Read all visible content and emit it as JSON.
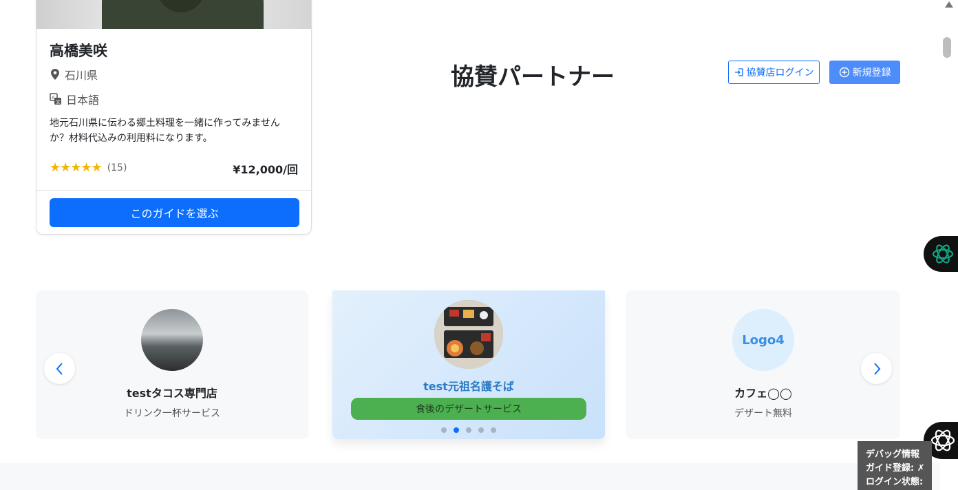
{
  "guide": {
    "name": "高橋美咲",
    "prefecture": "石川県",
    "language": "日本語",
    "description": "地元石川県に伝わる郷土料理を一緒に作ってみませんか？材料代込みの利用料になります。",
    "stars": "★★★★★",
    "rating": 5,
    "review_count": "(15)",
    "price": "¥12,000/回",
    "choose_label": "このガイドを選ぶ"
  },
  "sponsor": {
    "title": "協賛パートナー",
    "login_label": "協賛店ログイン",
    "register_label": "新規登録"
  },
  "carousel": {
    "items": [
      {
        "name": "testタコス専門店",
        "perk": "ドリンク一杯サービス"
      },
      {
        "name": "test元祖名護そば",
        "perk": "食後のデザートサービス"
      },
      {
        "name": "カフェ◯◯",
        "perk": "デザート無料",
        "logo_text": "Logo4"
      }
    ],
    "active_index": 1,
    "dot_count": 5
  },
  "debug": {
    "title": "デバッグ情報",
    "guide_registered": "ガイド登録: ✗",
    "login_status": "ログイン状態: ✓"
  },
  "colors": {
    "primary": "#0d6efd",
    "star": "#f5b400",
    "perk_pill": "#4caf50"
  },
  "icons": {
    "prefecture": "map-pin-icon",
    "language": "translate-icon",
    "login": "login-icon",
    "register": "plus-circle-icon",
    "prev": "chevron-left-icon",
    "next": "chevron-right-icon",
    "ai": "openai-icon"
  }
}
